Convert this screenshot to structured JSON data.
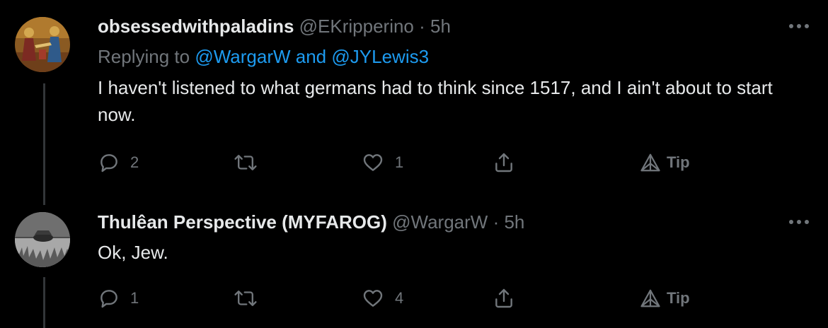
{
  "tweets": [
    {
      "display_name": "obsessedwithpaladins",
      "handle": "@EKripperino",
      "separator": "·",
      "time": "5h",
      "replying_prefix": "Replying to",
      "replying_to_1": "@WargarW",
      "replying_joiner": "and",
      "replying_to_2": "@JYLewis3",
      "text": "I haven't listened to what germans had to think since 1517, and I ain't about to start now.",
      "reply_count": "2",
      "retweet_count": "",
      "like_count": "1",
      "tip_label": "Tip"
    },
    {
      "display_name": "Thulêan Perspective (MYFAROG)",
      "handle": "@WargarW",
      "separator": "·",
      "time": "5h",
      "text": "Ok, Jew.",
      "reply_count": "1",
      "retweet_count": "",
      "like_count": "4",
      "tip_label": "Tip"
    }
  ],
  "icons": [
    "avatar-image",
    "more-icon",
    "reply-icon",
    "retweet-icon",
    "like-icon",
    "share-icon",
    "tip-icon"
  ],
  "colors": {
    "background": "#000000",
    "text": "#e7e9ea",
    "muted": "#71767b",
    "link": "#1d9bf0",
    "thread_line": "#333639"
  }
}
